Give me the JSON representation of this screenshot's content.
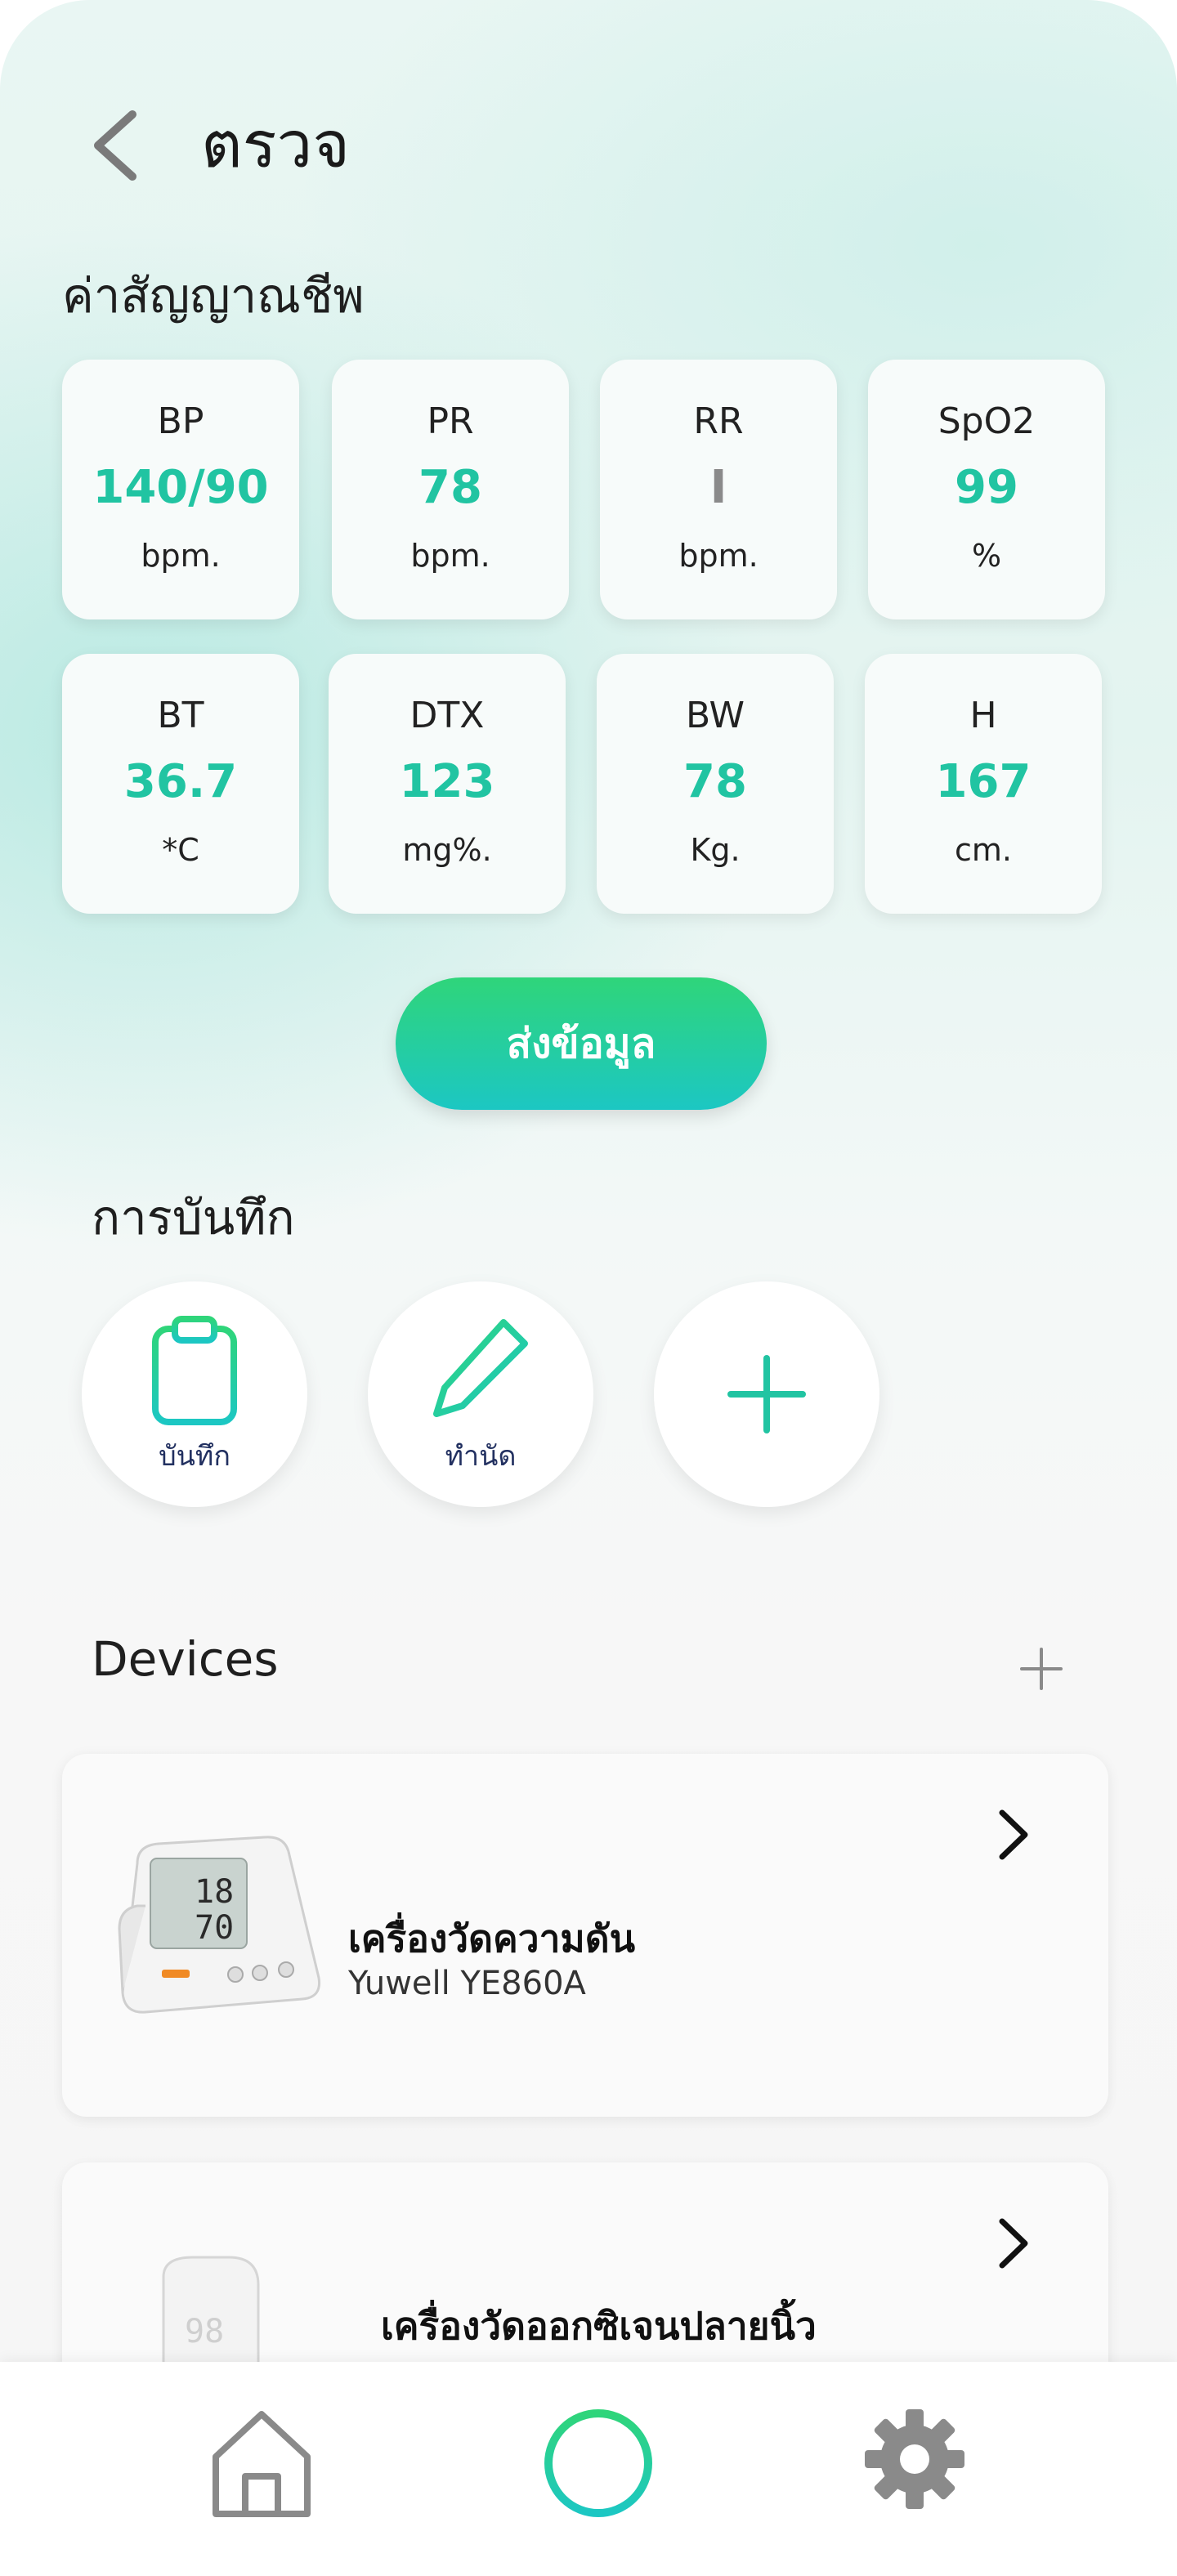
{
  "header": {
    "title": "ตรวจ"
  },
  "vitals": {
    "title": "ค่าสัญญาณชีพ",
    "items": [
      {
        "label": "BP",
        "value": "140/90",
        "unit": "bpm."
      },
      {
        "label": "PR",
        "value": "78",
        "unit": "bpm."
      },
      {
        "label": "RR",
        "value": "I",
        "unit": "bpm."
      },
      {
        "label": "SpO2",
        "value": "99",
        "unit": "%"
      },
      {
        "label": "BT",
        "value": "36.7",
        "unit": "*C"
      },
      {
        "label": "DTX",
        "value": "123",
        "unit": "mg%."
      },
      {
        "label": "BW",
        "value": "78",
        "unit": "Kg."
      },
      {
        "label": "H",
        "value": "167",
        "unit": "cm."
      }
    ]
  },
  "send_button": {
    "label": "ส่งข้อมูล"
  },
  "records": {
    "title": "การบันทึก",
    "items": [
      {
        "label": "บันทึก",
        "icon": "clipboard-icon"
      },
      {
        "label": "ทำนัด",
        "icon": "pencil-icon"
      },
      {
        "label": "",
        "icon": "plus-icon"
      }
    ]
  },
  "devices": {
    "title": "Devices",
    "items": [
      {
        "name": "เครื่องวัดความดัน",
        "model": "Yuwell YE860A",
        "device_reading_top": "18",
        "device_reading_bottom": "70"
      },
      {
        "name": "เครื่องวัดออกซิเจนปลายนิ้ว",
        "model": "",
        "device_reading_top": "98"
      }
    ]
  },
  "tabbar": {
    "items": [
      "home-icon",
      "add-circle-icon",
      "settings-gear-icon"
    ]
  },
  "colors": {
    "accent": "#21c4a2",
    "gradient_top": "#2fd57a",
    "gradient_bottom": "#1cc7c3"
  }
}
